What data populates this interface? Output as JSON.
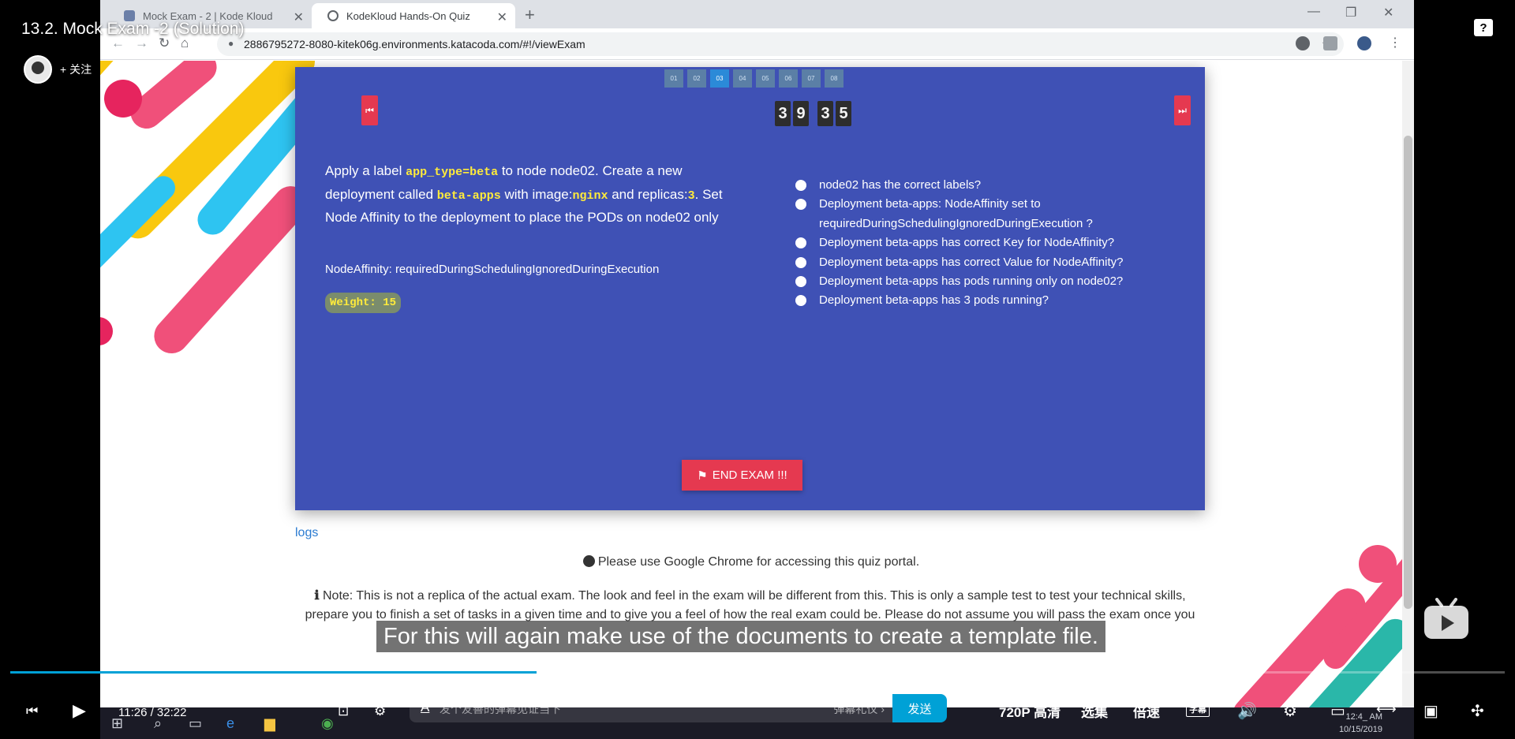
{
  "video": {
    "title": "13.2. Mock Exam -2 (Solution)",
    "follow_label": "+ 关注",
    "help_icon": "?",
    "subtitle": "For this will again make use of the documents to create a template file.",
    "progress_fraction": 0.352
  },
  "browser": {
    "tabs": [
      {
        "label": "Mock Exam - 2 | Kode Kloud",
        "close": "✕"
      },
      {
        "label": "KodeKloud Hands-On Quiz",
        "close": "✕"
      }
    ],
    "new_tab": "+",
    "url": "2886795272-8080-kitek06g.environments.katacoda.com/#!/viewExam"
  },
  "exam": {
    "question_numbers": [
      "01",
      "02",
      "03",
      "04",
      "05",
      "06",
      "07",
      "08"
    ],
    "active_question": "03",
    "timer_digits": [
      "3",
      "9",
      "3",
      "5"
    ],
    "question": {
      "p1": "Apply a label ",
      "c1": "app_type=beta",
      "p2": " to node node02. Create a new deployment called ",
      "c2": "beta-apps",
      "p3": " with image:",
      "c3": "nginx",
      "p4": " and replicas:",
      "c4": "3",
      "p5": ". Set Node Affinity to the deployment to place the PODs on node02 only"
    },
    "affinity_note": "NodeAffinity: requiredDuringSchedulingIgnoredDuringExecution",
    "weight": "Weight: 15",
    "checks": [
      "node02 has the correct labels?",
      "Deployment beta-apps: NodeAffinity set to requiredDuringSchedulingIgnoredDuringExecution ?",
      "Deployment beta-apps has correct Key for NodeAffinity?",
      "Deployment beta-apps has correct Value for NodeAffinity?",
      "Deployment beta-apps has pods running only on node02?",
      "Deployment beta-apps has 3 pods running?"
    ],
    "end_button": "END EXAM !!!",
    "logs_link": "logs",
    "chrome_note": "Please use Google Chrome for accessing this quiz portal.",
    "disclaimer": "Note: This is not a replica of the actual exam. The look and feel in the exam will be different from this. This is only a sample test to test your technical skills, prepare you to finish a set of tasks in a given time and to give you a feel of how the real exam could be. Please do not assume you will pass the exam once you"
  },
  "taskbar": {
    "clock_time": "12:4_ AM",
    "clock_date": "10/15/2019"
  },
  "player": {
    "time": "11:26 / 32:22",
    "danmu_placeholder": "发个友善的弹幕见证当下",
    "danmu_gift": "弹幕礼仪 ›",
    "send": "发送",
    "quality": "720P 高清",
    "episodes": "选集",
    "speed": "倍速",
    "subtitle_tag": "字幕"
  },
  "colors": {
    "panel": "#3f51b5",
    "accent_red": "#e53950",
    "code_yellow": "#ffeb3b",
    "bili_blue": "#00a1d6"
  }
}
